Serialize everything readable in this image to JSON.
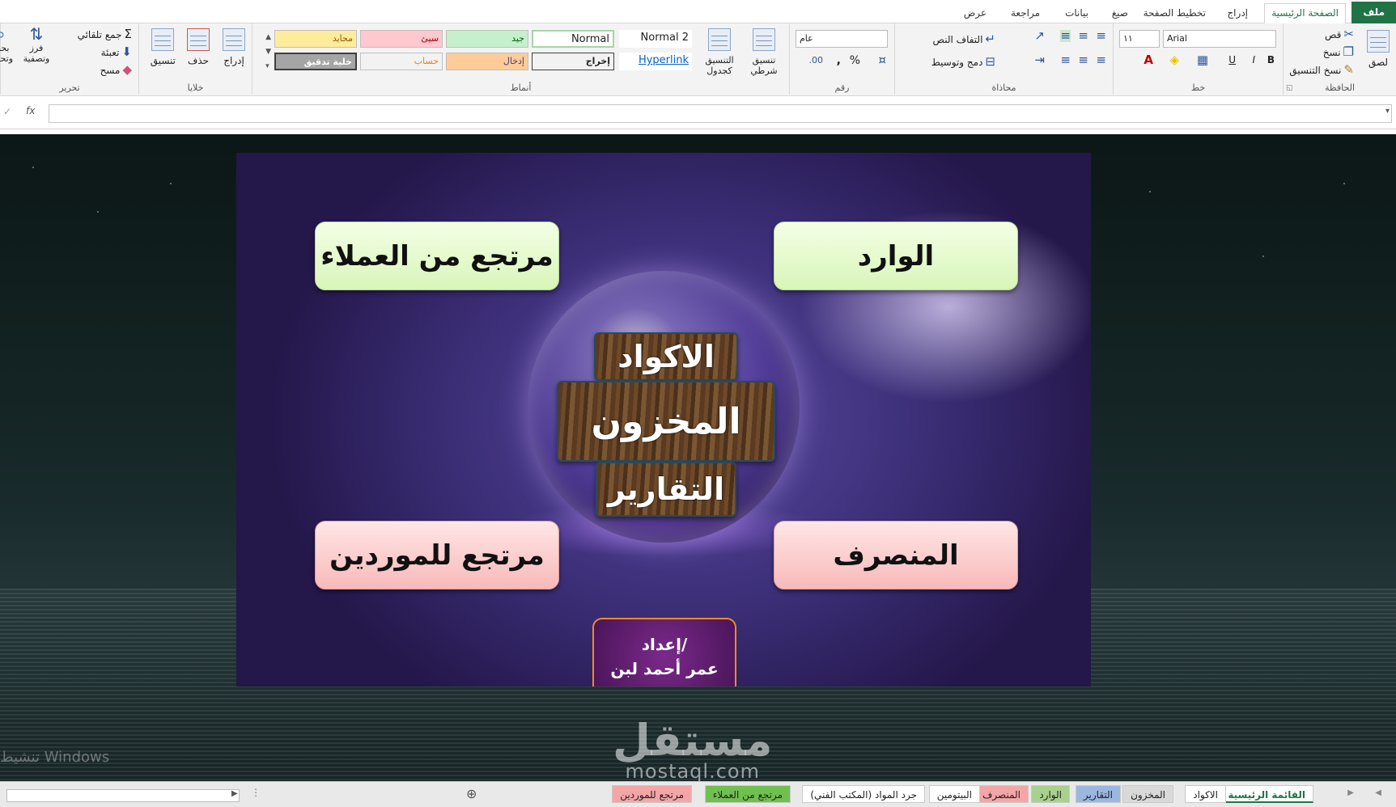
{
  "ribbon_tabs": {
    "file": "ملف",
    "home": "الصفحة الرئيسية",
    "insert": "إدراج",
    "layout": "تخطيط الصفحة",
    "formulas": "صيغ",
    "data": "بيانات",
    "review": "مراجعة",
    "view": "عرض"
  },
  "clipboard": {
    "label": "الحافظة",
    "paste": "لصق",
    "cut": "قص",
    "copy": "نسخ",
    "format_painter": "نسخ التنسيق"
  },
  "font": {
    "label": "خط",
    "name": "Arial",
    "size": "١١",
    "bold": "B",
    "italic": "I",
    "underline": "U"
  },
  "alignment": {
    "label": "محاذاة",
    "wrap": "التفاف النص",
    "merge": "دمج وتوسيط"
  },
  "number": {
    "label": "رقم",
    "format": "عام",
    "percent": "%",
    "comma": ","
  },
  "styles": {
    "label": "أنماط",
    "conditional": "تنسيق شرطي",
    "as_table": "التنسيق كجدول",
    "normal2": "Normal 2",
    "normal": "Normal",
    "hyperlink": "Hyperlink",
    "output": "إخراج",
    "neutral": "محايد",
    "bad": "سيئ",
    "good": "جيد",
    "input": "إدخال",
    "calc": "حساب",
    "check": "خلية تدقيق"
  },
  "cells": {
    "label": "خلايا",
    "insert": "إدراج",
    "delete": "حذف",
    "format": "تنسيق"
  },
  "editing": {
    "label": "تحرير",
    "autosum": "جمع تلقائي",
    "fill": "تعبئة",
    "clear": "مسح",
    "sort": "فرز وتصفية",
    "find": "بحث وتحديد"
  },
  "formula": {
    "fx": "fx"
  },
  "board": {
    "incoming": "الوارد",
    "customer_returns": "مرتجع من العملاء",
    "outgoing": "المنصرف",
    "supplier_returns": "مرتجع للموردين",
    "codes": "الاكواد",
    "inventory": "المخزون",
    "reports": "التقارير",
    "credit_title": "إعداد/",
    "credit_name": "عمر أحمد لبن"
  },
  "watermark": {
    "line1": "مستقل",
    "line2": "mostaql.com"
  },
  "activation": "تنشيط Windows",
  "sheet_tabs": [
    "القائمة الرئيسية",
    "الاكواد",
    "المخزون",
    "التقارير",
    "الوارد",
    "المنصرف",
    "البيتومين",
    "جرد المواد (المكتب الفني)",
    "مرتجع من العملاء",
    "مرتجع للموردين"
  ],
  "colors": {
    "excel_green": "#217346",
    "green_button": "#d8f5b8",
    "pink_button": "#f8b9b9",
    "credit_border": "#f08a2a"
  }
}
